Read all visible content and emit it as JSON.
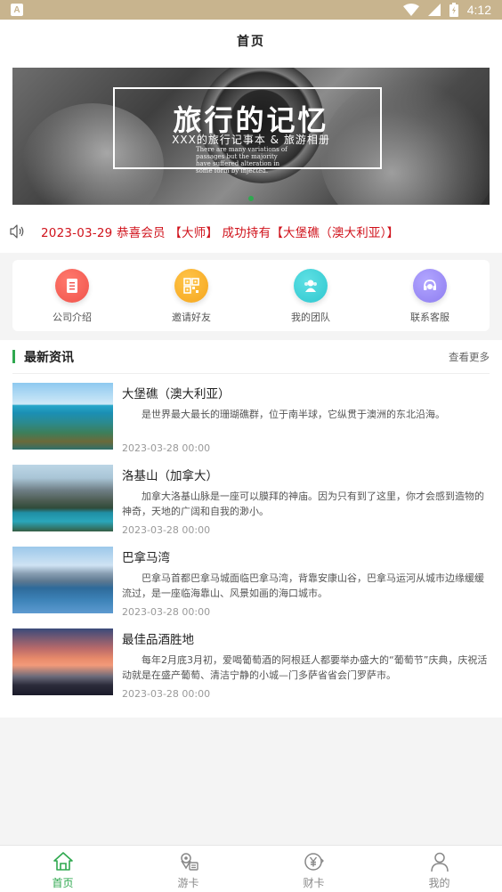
{
  "status_bar": {
    "time": "4:12",
    "app_badge": "A"
  },
  "header": {
    "title": "首页"
  },
  "banner": {
    "title": "旅行的记忆",
    "subtitle": "XXX的旅行记事本 & 旅游相册",
    "small_text": "There are many variations of passages but the majority have suffered alteration in some form by injected."
  },
  "notice": {
    "text": "2023-03-29 恭喜会员 【大师】 成功持有【大堡礁（澳大利亚）】"
  },
  "menu": {
    "items": [
      {
        "label": "公司介绍",
        "icon": "document-icon",
        "color": "#f0524a"
      },
      {
        "label": "邀请好友",
        "icon": "qrcode-icon",
        "color": "#f5a51c"
      },
      {
        "label": "我的团队",
        "icon": "team-icon",
        "color": "#2ec7cf"
      },
      {
        "label": "联系客服",
        "icon": "headset-icon",
        "color": "#8e7df0"
      }
    ]
  },
  "news": {
    "title": "最新资讯",
    "more": "查看更多",
    "items": [
      {
        "title": "大堡礁（澳大利亚）",
        "desc": "是世界最大最长的珊瑚礁群，位于南半球，它纵贯于澳洲的东北沿海。",
        "date": "2023-03-28 00:00"
      },
      {
        "title": "洛基山（加拿大）",
        "desc": "加拿大洛基山脉是一座可以膜拜的神庙。因为只有到了这里，你才会感到造物的神奇，天地的广阔和自我的渺小。",
        "date": "2023-03-28 00:00"
      },
      {
        "title": "巴拿马湾",
        "desc": "巴拿马首都巴拿马城面临巴拿马湾，背靠安康山谷，巴拿马运河从城市边缘缓缓流过，是一座临海靠山、风景如画的海口城市。",
        "date": "2023-03-28 00:00"
      },
      {
        "title": "最佳品酒胜地",
        "desc": "每年2月底3月初，爱喝葡萄酒的阿根廷人都要举办盛大的“葡萄节”庆典，庆祝活动就是在盛产葡萄、清洁宁静的小城—门多萨省省会门罗萨市。",
        "date": "2023-03-28 00:00"
      }
    ]
  },
  "tabbar": {
    "items": [
      {
        "label": "首页",
        "icon": "home-icon",
        "active": true
      },
      {
        "label": "游卡",
        "icon": "travel-card-icon",
        "active": false
      },
      {
        "label": "财卡",
        "icon": "finance-card-icon",
        "active": false
      },
      {
        "label": "我的",
        "icon": "profile-icon",
        "active": false
      }
    ]
  },
  "colors": {
    "accent": "#2fa84f",
    "notice": "#d0121b",
    "status_bar": "#c8b48e"
  }
}
